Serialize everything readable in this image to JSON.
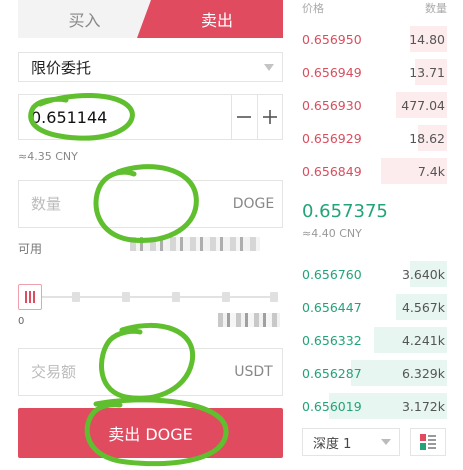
{
  "tabs": {
    "buy": "买入",
    "sell": "卖出",
    "active": "sell"
  },
  "order_type": {
    "label": "限价委托"
  },
  "price": {
    "value": "0.651144",
    "minus": "—",
    "plus": "+"
  },
  "price_cny": "≈4.35 CNY",
  "quantity": {
    "placeholder": "数量",
    "unit": "DOGE"
  },
  "available": {
    "label": "可用"
  },
  "slider": {
    "min_label": "0",
    "level": 0
  },
  "amount": {
    "placeholder": "交易额",
    "unit": "USDT"
  },
  "sell_button": "卖出 DOGE",
  "order_book": {
    "header": {
      "price": "价格",
      "qty": "数量"
    },
    "asks": [
      {
        "price": "0.656950",
        "qty": "14.80",
        "depth": 0.25
      },
      {
        "price": "0.656949",
        "qty": "13.71",
        "depth": 0.22
      },
      {
        "price": "0.656930",
        "qty": "477.04",
        "depth": 0.35
      },
      {
        "price": "0.656929",
        "qty": "18.62",
        "depth": 0.2
      },
      {
        "price": "0.656849",
        "qty": "7.4k",
        "depth": 0.45
      }
    ],
    "last_price": "0.657375",
    "last_cny": "≈4.40 CNY",
    "bids": [
      {
        "price": "0.656760",
        "qty": "3.640k",
        "depth": 0.25
      },
      {
        "price": "0.656447",
        "qty": "4.567k",
        "depth": 0.35
      },
      {
        "price": "0.656332",
        "qty": "4.241k",
        "depth": 0.5
      },
      {
        "price": "0.656287",
        "qty": "6.329k",
        "depth": 0.65
      },
      {
        "price": "0.656019",
        "qty": "3.172k",
        "depth": 0.8
      }
    ],
    "depth_select": "深度 1"
  },
  "colors": {
    "sell": "#e14b60",
    "buy": "#23a37a",
    "annotation": "#5fbf2e"
  }
}
